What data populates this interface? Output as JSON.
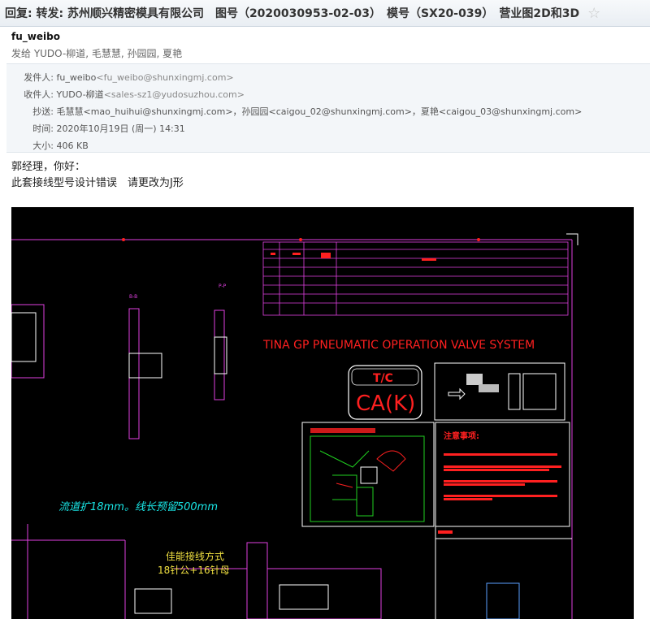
{
  "email": {
    "subject": "回复: 转发: 苏州顺兴精密模具有限公司　图号（2020030953-02-03）　模号（SX20-039）　营业图2D和3D",
    "star_icon": "☆",
    "sender_name": "fu_weibo",
    "sent_to_line": "发给 YUDO-柳道, 毛慧慧, 孙园园, 夏艳",
    "meta": {
      "from_label": "发件人:",
      "from_name": "fu_weibo",
      "from_email": "<fu_weibo@shunxingmj.com>",
      "to_label": "收件人:",
      "to_name": "YUDO-柳道",
      "to_email": "<sales-sz1@yudosuzhou.com>",
      "cc_label": "抄送:",
      "cc_value": "毛慧慧<mao_huihui@shunxingmj.com>，孙园园<caigou_02@shunxingmj.com>，夏艳<caigou_03@shunxingmj.com>",
      "time_label": "时间:",
      "time_value": "2020年10月19日 (周一) 14:31",
      "size_label": "大小:",
      "size_value": "406 KB"
    },
    "body_lines": [
      "郭经理，你好：",
      "此套接线型号设计错误　请更改为J形"
    ]
  },
  "drawing": {
    "section_label_b": "B-B",
    "section_label_p": "P-P",
    "system_title": "TINA GP PNEUMATIC OPERATION VALVE SYSTEM",
    "tc_label": "T/C",
    "tc_value": "CA(K)",
    "runner_note": "流道扩18mm。线长预留500mm",
    "wiring_title": "佳能接线方式",
    "wiring_detail": "18针公+16针母",
    "notes_title": "注意事项:",
    "colors": {
      "background": "#000000",
      "magenta": "#e040e0",
      "red": "#ff2020",
      "white": "#ffffff",
      "cyan": "#19e6e6",
      "green": "#20d020",
      "yellow": "#f0e040"
    }
  }
}
